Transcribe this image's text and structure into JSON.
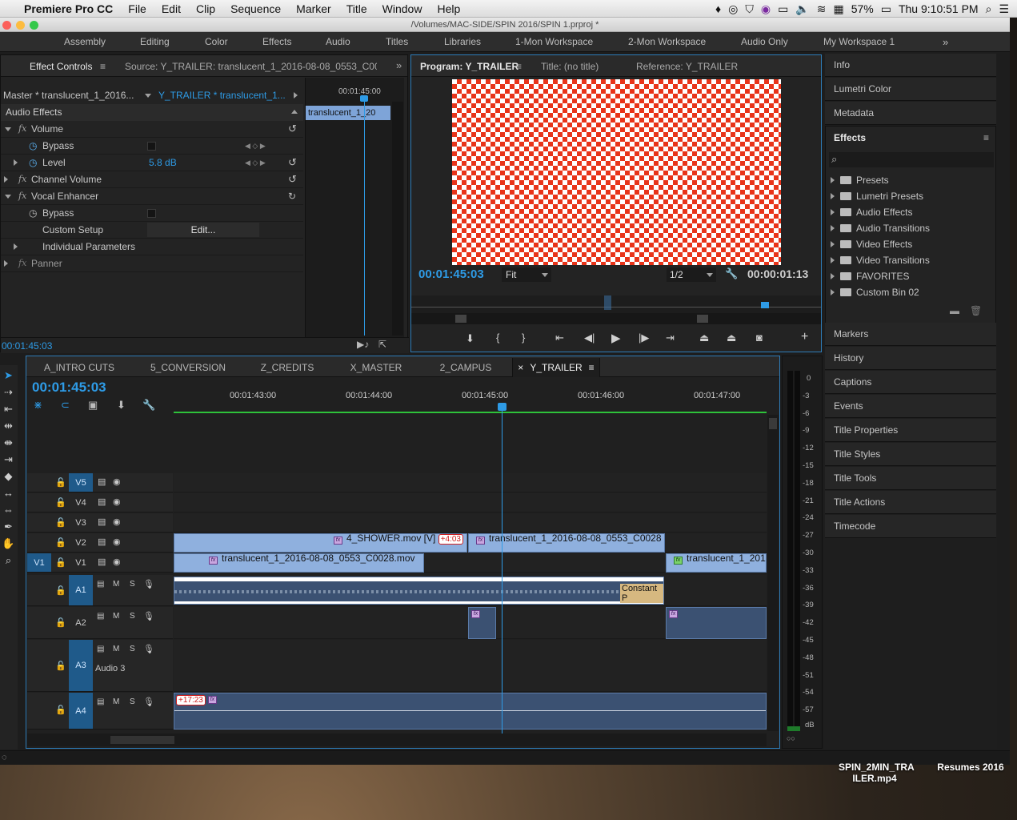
{
  "menubar": {
    "app": "Premiere Pro CC",
    "items": [
      "File",
      "Edit",
      "Clip",
      "Sequence",
      "Marker",
      "Title",
      "Window",
      "Help"
    ],
    "battery": "57%",
    "clock": "Thu 9:10:51 PM"
  },
  "window": {
    "title": "/Volumes/MAC-SIDE/SPIN 2016/SPIN 1.prproj *"
  },
  "workspaces": [
    "Assembly",
    "Editing",
    "Color",
    "Effects",
    "Audio",
    "Titles",
    "Libraries",
    "1-Mon Workspace",
    "2-Mon Workspace",
    "Audio Only",
    "My Workspace 1"
  ],
  "effect_controls": {
    "tab": "Effect Controls",
    "source_tab": "Source: Y_TRAILER: translucent_1_2016-08-08_0553_C00",
    "master": "Master * translucent_1_2016...",
    "sequence_clip": "Y_TRAILER * translucent_1...",
    "mini_time": "00:01:45:00",
    "mini_clip": "translucent_1_20",
    "section": "Audio Effects",
    "rows": {
      "volume": "Volume",
      "bypass": "Bypass",
      "level": "Level",
      "level_value": "5.8 dB",
      "channel_volume": "Channel Volume",
      "vocal_enhancer": "Vocal Enhancer",
      "bypass2": "Bypass",
      "custom_setup": "Custom Setup",
      "edit": "Edit...",
      "individual": "Individual Parameters",
      "panner": "Panner"
    },
    "fx": "fx",
    "timecode": "00:01:45:03"
  },
  "program": {
    "tabs": [
      "Program: Y_TRAILER",
      "Title: (no title)",
      "Reference: Y_TRAILER"
    ],
    "timecode": "00:01:45:03",
    "fit": "Fit",
    "resolution": "1/2",
    "duration": "00:00:01:13"
  },
  "right_panels": {
    "top": [
      "Info",
      "Lumetri Color",
      "Metadata"
    ],
    "effects_title": "Effects",
    "effects_items": [
      "Presets",
      "Lumetri Presets",
      "Audio Effects",
      "Audio Transitions",
      "Video Effects",
      "Video Transitions",
      "FAVORITES",
      "Custom Bin 02"
    ],
    "bottom": [
      "Markers",
      "History",
      "Captions",
      "Events",
      "Title Properties",
      "Title Styles",
      "Title Tools",
      "Title Actions",
      "Timecode"
    ]
  },
  "timeline": {
    "tabs": [
      "A_INTRO CUTS",
      "5_CONVERSION",
      "Z_CREDITS",
      "X_MASTER",
      "2_CAMPUS",
      "Y_TRAILER"
    ],
    "active": "Y_TRAILER",
    "close": "×",
    "timecode": "00:01:45:03",
    "ruler": [
      "00:01:43:00",
      "00:01:44:00",
      "00:01:45:00",
      "00:01:46:00",
      "00:01:47:00"
    ],
    "tracks": {
      "v5": "V5",
      "v4": "V4",
      "v3": "V3",
      "v2": "V2",
      "v1": "V1",
      "src": "V1",
      "a1": "A1",
      "a2": "A2",
      "a3": "A3",
      "a4": "A4",
      "a3name": "Audio 3",
      "m": "M",
      "s": "S"
    },
    "clips": {
      "shower": "4_SHOWER.mov [V]",
      "shower_badge": "+4:03",
      "v2b": "translucent_1_2016-08-08_0553_C0028",
      "v1a": "translucent_1_2016-08-08_0553_C0028.mov",
      "v1b": "translucent_1_201",
      "a1_label": "Constant P",
      "a4_badge": "+17:23"
    }
  },
  "meter": {
    "labels": [
      "0",
      "-3",
      "-6",
      "-9",
      "-12",
      "-15",
      "-18",
      "-21",
      "-24",
      "-27",
      "-30",
      "-33",
      "-36",
      "-39",
      "-42",
      "-45",
      "-48",
      "-51",
      "-54",
      "-57",
      "dB"
    ]
  },
  "desktop": {
    "file1": "SPIN_2MIN_TRA ILER.mp4",
    "file2": "Resumes 2016"
  }
}
